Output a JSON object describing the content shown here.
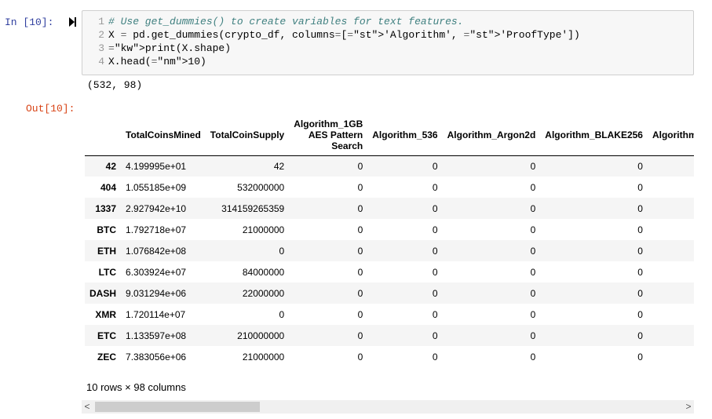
{
  "cell": {
    "in_prompt": "In [10]:",
    "out_prompt": "Out[10]:",
    "code_lines": [
      {
        "n": "1",
        "comment": "# Use get_dummies() to create variables for text features."
      },
      {
        "n": "2",
        "code": "X = pd.get_dummies(crypto_df, columns=['Algorithm', 'ProofType'])"
      },
      {
        "n": "3",
        "code": "print(X.shape)"
      },
      {
        "n": "4",
        "code": "X.head(10)"
      }
    ],
    "stdout": "(532, 98)"
  },
  "table": {
    "columns": [
      "TotalCoinsMined",
      "TotalCoinSupply",
      "Algorithm_1GB AES Pattern Search",
      "Algorithm_536",
      "Algorithm_Argon2d",
      "Algorithm_BLAKE256",
      "Algorithm_Bl"
    ],
    "rows": [
      {
        "index": "42",
        "cells": [
          "4.199995e+01",
          "42",
          "0",
          "0",
          "0",
          "0",
          ""
        ]
      },
      {
        "index": "404",
        "cells": [
          "1.055185e+09",
          "532000000",
          "0",
          "0",
          "0",
          "0",
          ""
        ]
      },
      {
        "index": "1337",
        "cells": [
          "2.927942e+10",
          "314159265359",
          "0",
          "0",
          "0",
          "0",
          ""
        ]
      },
      {
        "index": "BTC",
        "cells": [
          "1.792718e+07",
          "21000000",
          "0",
          "0",
          "0",
          "0",
          ""
        ]
      },
      {
        "index": "ETH",
        "cells": [
          "1.076842e+08",
          "0",
          "0",
          "0",
          "0",
          "0",
          ""
        ]
      },
      {
        "index": "LTC",
        "cells": [
          "6.303924e+07",
          "84000000",
          "0",
          "0",
          "0",
          "0",
          ""
        ]
      },
      {
        "index": "DASH",
        "cells": [
          "9.031294e+06",
          "22000000",
          "0",
          "0",
          "0",
          "0",
          ""
        ]
      },
      {
        "index": "XMR",
        "cells": [
          "1.720114e+07",
          "0",
          "0",
          "0",
          "0",
          "0",
          ""
        ]
      },
      {
        "index": "ETC",
        "cells": [
          "1.133597e+08",
          "210000000",
          "0",
          "0",
          "0",
          "0",
          ""
        ]
      },
      {
        "index": "ZEC",
        "cells": [
          "7.383056e+06",
          "21000000",
          "0",
          "0",
          "0",
          "0",
          ""
        ]
      }
    ],
    "footer": "10 rows × 98 columns"
  },
  "scrollbar": {
    "left_arrow": "<",
    "right_arrow": ">"
  }
}
